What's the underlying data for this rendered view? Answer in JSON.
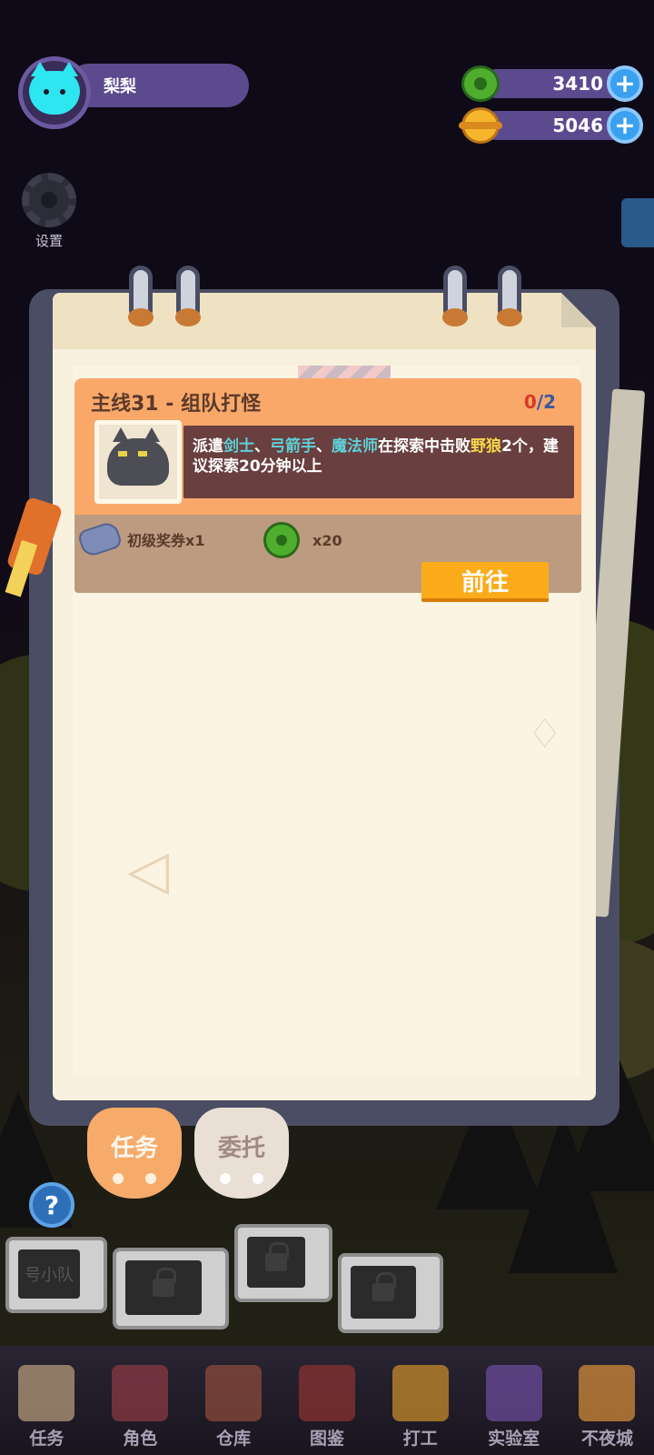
{
  "profile": {
    "name": "梨梨"
  },
  "currencies": [
    {
      "icon": "green-coin-icon",
      "amount": "3410"
    },
    {
      "icon": "gold-coin-icon",
      "amount": "5046"
    }
  ],
  "settings": {
    "label": "设置"
  },
  "quest": {
    "title": "主线31 - 组队打怪",
    "progress_current": "0",
    "progress_sep": "/",
    "progress_total": "2",
    "desc_prefix": "派遣",
    "role1": "剑士",
    "sep1": "、",
    "role2": "弓箭手",
    "sep2": "、",
    "role3": "魔法师",
    "desc_mid": "在探索中击败",
    "enemy": "野狼",
    "desc_suffix": "2个，建议探索20分钟以上",
    "rewards": [
      {
        "icon": "ticket-icon",
        "label": "初级奖券x1"
      },
      {
        "icon": "green-coin-icon",
        "label": "x20"
      }
    ],
    "go_label": "前往"
  },
  "tabs": {
    "active": "任务",
    "inactive": "委托"
  },
  "monitor_text": "号小队",
  "nav": [
    {
      "label": "任务",
      "color": "#b49a7a"
    },
    {
      "label": "角色",
      "color": "#8a3a44"
    },
    {
      "label": "仓库",
      "color": "#8a4a3a"
    },
    {
      "label": "图鉴",
      "color": "#8a3232"
    },
    {
      "label": "打工",
      "color": "#c48a2a"
    },
    {
      "label": "实验室",
      "color": "#6a4a9a"
    },
    {
      "label": "不夜城",
      "color": "#d08a3a"
    }
  ]
}
